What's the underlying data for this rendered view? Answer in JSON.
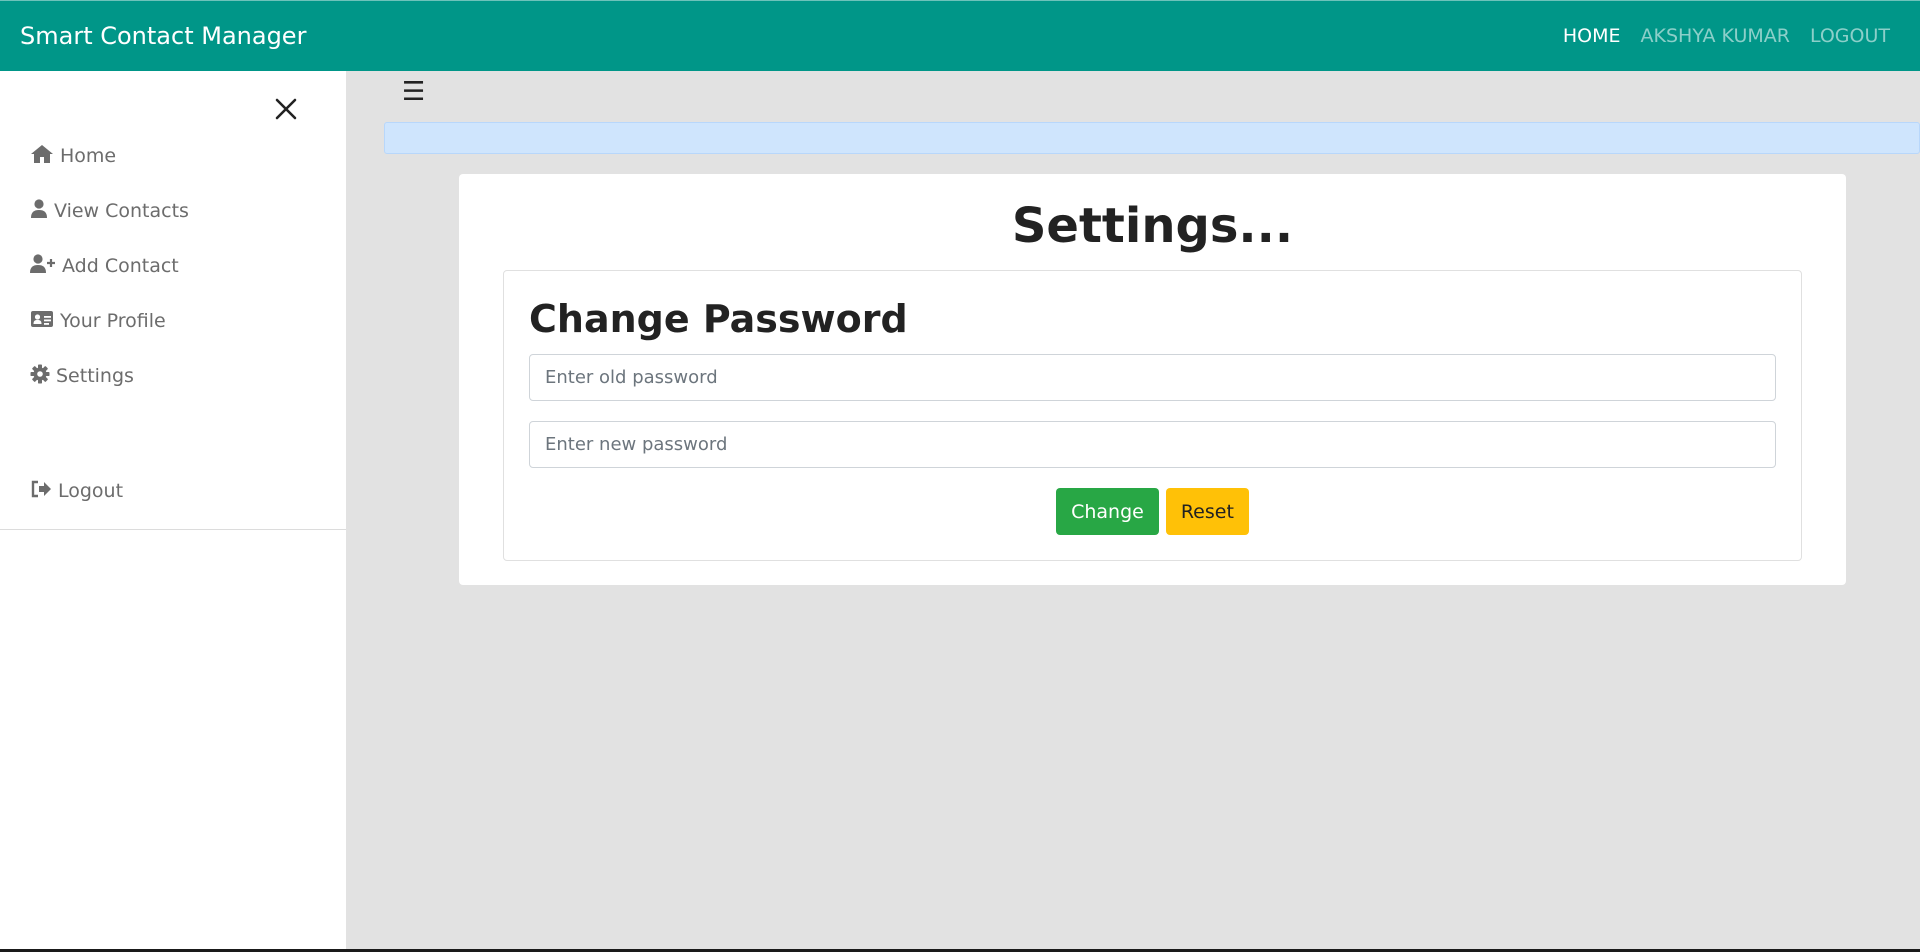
{
  "navbar": {
    "brand": "Smart Contact Manager",
    "links": {
      "home": "HOME",
      "user": "AKSHYA KUMAR",
      "logout": "LOGOUT"
    },
    "color": "#009688"
  },
  "sidebar": {
    "close_icon": "close-icon",
    "items": [
      {
        "label": "Home",
        "icon": "home-icon"
      },
      {
        "label": "View Contacts",
        "icon": "user-icon"
      },
      {
        "label": "Add Contact",
        "icon": "user-plus-icon"
      },
      {
        "label": "Your Profile",
        "icon": "id-card-icon"
      },
      {
        "label": "Settings",
        "icon": "gear-icon"
      },
      {
        "label": "Logout",
        "icon": "sign-out-icon"
      }
    ]
  },
  "main": {
    "toggle_icon": "hamburger-icon",
    "title": "Settings...",
    "change_password": {
      "heading": "Change Password",
      "old_password_placeholder": "Enter old password",
      "new_password_placeholder": "Enter new password",
      "change_label": "Change",
      "reset_label": "Reset"
    }
  },
  "colors": {
    "success": "#28a745",
    "warning": "#ffc107",
    "alert": "#cfe5fd"
  }
}
